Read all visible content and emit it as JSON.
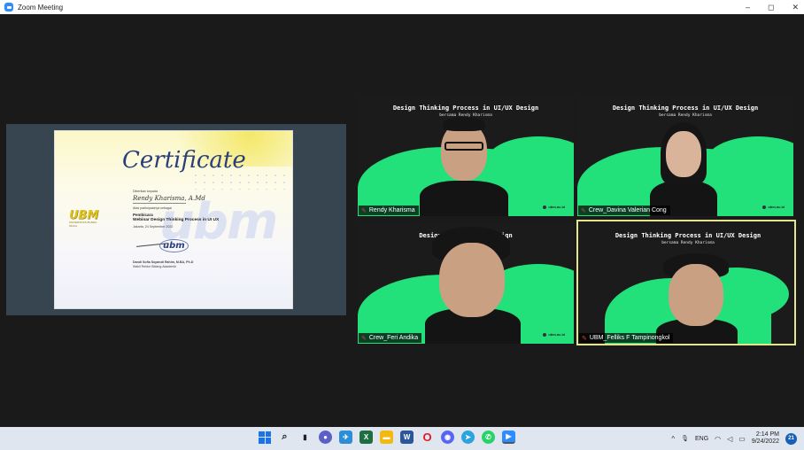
{
  "window": {
    "title": "Zoom Meeting",
    "minimize": "–",
    "maximize": "◻",
    "close": "✕"
  },
  "share": {
    "certificate": {
      "title": "Certificate",
      "given_to": "Diberikan kepada",
      "recipient": "Rendy Kharisma, A.Md",
      "recognition": "Atas partisipasinya sebagai",
      "role": "Pembicara",
      "event": "Webinar Design Thinking Process in UI UX",
      "date": "Jakarta, 24 September 2022",
      "signer": "Dandi Sofia Sopandi Rahim, M.BA, Ph.D",
      "signer_title": "Wakil Rektor Bidang Akademik",
      "watermark": "ubm",
      "logo_text": "UBM",
      "logo_sub": "UNIVERSITAS BUNDA MULIA",
      "stamp": "ubm"
    }
  },
  "participants": [
    {
      "name": "Rendy Kharisma",
      "header": "Design Thinking Process in UI/UX Design",
      "subheader": "bersama Rendy Kharisma",
      "watermark": "ubm.ac.id"
    },
    {
      "name": "Crew_Davina Valerian Cong",
      "header": "Design Thinking Process in UI/UX Design",
      "subheader": "bersama Rendy Kharisma",
      "watermark": "ubm.ac.id"
    },
    {
      "name": "Crew_Feri Andika",
      "header": "Design Thinki      I/UX Design",
      "subheader": "",
      "watermark": "ubm.ac.id"
    },
    {
      "name": "UBM_Felliks F Tampinongkol",
      "header": "Design Thinking Process in UI/UX Design",
      "subheader": "bersama Rendy Kharisma",
      "watermark": ""
    }
  ],
  "taskbar": {
    "apps": [
      {
        "name": "start",
        "color": "#1a73e8"
      },
      {
        "name": "search",
        "glyph": "⌕",
        "color": "#222"
      },
      {
        "name": "task-view",
        "glyph": "▮",
        "color": "#222"
      },
      {
        "name": "chat",
        "glyph": "●",
        "color": "#5b5fc7"
      },
      {
        "name": "telegram-badge",
        "glyph": "✈",
        "color": "#2a8fd6"
      },
      {
        "name": "excel",
        "glyph": "X",
        "color": "#1d6f42"
      },
      {
        "name": "file-explorer",
        "glyph": "▬",
        "color": "#f2b90f"
      },
      {
        "name": "word",
        "glyph": "W",
        "color": "#2b579a"
      },
      {
        "name": "opera",
        "glyph": "O",
        "color": "#e01b24"
      },
      {
        "name": "discord",
        "glyph": "◉",
        "color": "#5865f2"
      },
      {
        "name": "telegram",
        "glyph": "➤",
        "color": "#2aa3de"
      },
      {
        "name": "whatsapp",
        "glyph": "✆",
        "color": "#25d366"
      },
      {
        "name": "zoom",
        "glyph": "▶",
        "color": "#2d8cff"
      }
    ],
    "tray": {
      "chevron": "^",
      "mic": "🎤",
      "lang": "ENG",
      "wifi": "wifi",
      "volume": "vol",
      "battery": "bat",
      "time": "2:14 PM",
      "date": "9/24/2022",
      "notifications": "21"
    }
  }
}
